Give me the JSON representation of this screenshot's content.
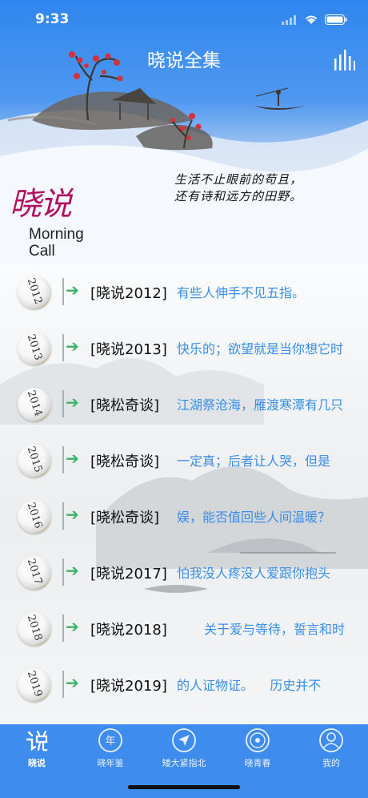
{
  "status_bar": {
    "time": "9:33"
  },
  "header": {
    "title": "晓说全集",
    "brand_cn": "晓说",
    "brand_en": "Morning\nCall",
    "poem_lines": [
      "生活不止眼前的苟且，",
      "还有诗和远方的田野。"
    ]
  },
  "rows": [
    {
      "year": "2012",
      "tag": "[晓说2012]",
      "text": "有些人伸手不见五指。"
    },
    {
      "year": "2013",
      "tag": "[晓说2013]",
      "text": "快乐的；欲望就是当你想它时"
    },
    {
      "year": "2014",
      "tag": "[晓松奇谈]",
      "text": "江湖祭沧海，雁渡寒潭有几只"
    },
    {
      "year": "2015",
      "tag": "[晓松奇谈]",
      "text": "一定真；后者让人哭，但是"
    },
    {
      "year": "2016",
      "tag": "[晓松奇谈]",
      "text": "娱，能否值回些人间温暖？"
    },
    {
      "year": "2017",
      "tag": "[晓说2017]",
      "text": "怕我没人疼没人爱跟你抱头"
    },
    {
      "year": "2018",
      "tag": "[晓说2018]",
      "text": "关于爱与等待，誓言和时"
    },
    {
      "year": "2019",
      "tag": "[晓说2019]",
      "text": "的人证物证。    历史并不"
    }
  ],
  "tabs": [
    {
      "label": "晓说",
      "icon": "xiaoshuo-logo-icon",
      "active": true
    },
    {
      "label": "晓年鉴",
      "icon": "year-badge-icon",
      "active": false
    },
    {
      "label": "矮大紧指北",
      "icon": "compass-arrow-icon",
      "active": false
    },
    {
      "label": "晓青春",
      "icon": "vinyl-record-icon",
      "active": false
    },
    {
      "label": "我的",
      "icon": "user-profile-icon",
      "active": false
    }
  ],
  "colors": {
    "accent": "#3f8cef",
    "tag_text": "#111111",
    "marquee_text": "#3a8ee6",
    "arrow": "#3ab26b"
  }
}
